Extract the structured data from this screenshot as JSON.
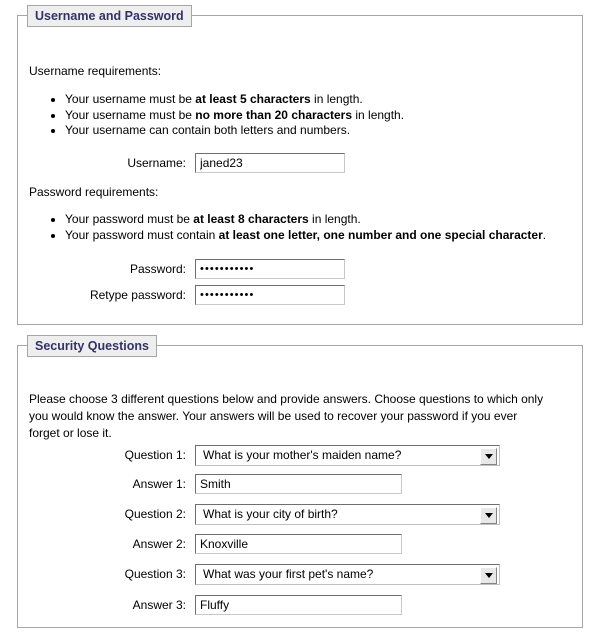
{
  "credentials": {
    "legend": "Username and Password",
    "username_requirements_heading": "Username requirements:",
    "username_requirements": [
      {
        "pre": "Your username must be ",
        "strong": "at least 5 characters",
        "post": " in length."
      },
      {
        "pre": "Your username must be ",
        "strong": "no more than 20 characters",
        "post": " in length."
      },
      {
        "pre": "Your username can contain both letters and numbers.",
        "strong": "",
        "post": ""
      }
    ],
    "username_label": "Username:",
    "username_value": "janed23",
    "username_placeholder": "",
    "password_requirements_heading": "Password requirements:",
    "password_requirements": [
      {
        "pre": "Your password must be ",
        "strong": "at least 8 characters",
        "post": " in length."
      },
      {
        "pre": "Your password must contain ",
        "strong": "at least one letter, one number and one special character",
        "post": "."
      }
    ],
    "password_label": "Password:",
    "password_value": "•••••••••••",
    "password_placeholder": "",
    "retype_label": "Retype password:",
    "retype_value": "•••••••••••",
    "retype_placeholder": ""
  },
  "security": {
    "legend": "Security Questions",
    "intro": "Please choose 3 different questions below and provide answers. Choose questions to which only you would know the answer. Your answers will be used to recover your password if you ever forget or lose it.",
    "rows": [
      {
        "question_label": "Question 1:",
        "question_value": "What is your mother's maiden name?",
        "answer_label": "Answer 1:",
        "answer_value": "Smith",
        "answer_placeholder": ""
      },
      {
        "question_label": "Question 2:",
        "question_value": "What is your city of birth?",
        "answer_label": "Answer 2:",
        "answer_value": "Knoxville",
        "answer_placeholder": ""
      },
      {
        "question_label": "Question 3:",
        "question_value": "What was your first pet's name?",
        "answer_label": "Answer 3:",
        "answer_value": "Fluffy",
        "answer_placeholder": ""
      }
    ],
    "dropdown_icon": "chevron-down-icon"
  },
  "colors": {
    "legend_text": "#333366",
    "legend_background": "#eeeeee",
    "fieldset_border": "#a6a6a6",
    "page_background": "#ffffff",
    "input_border_dark": "#6f6f6f",
    "input_border_light": "#c8c8c8"
  }
}
